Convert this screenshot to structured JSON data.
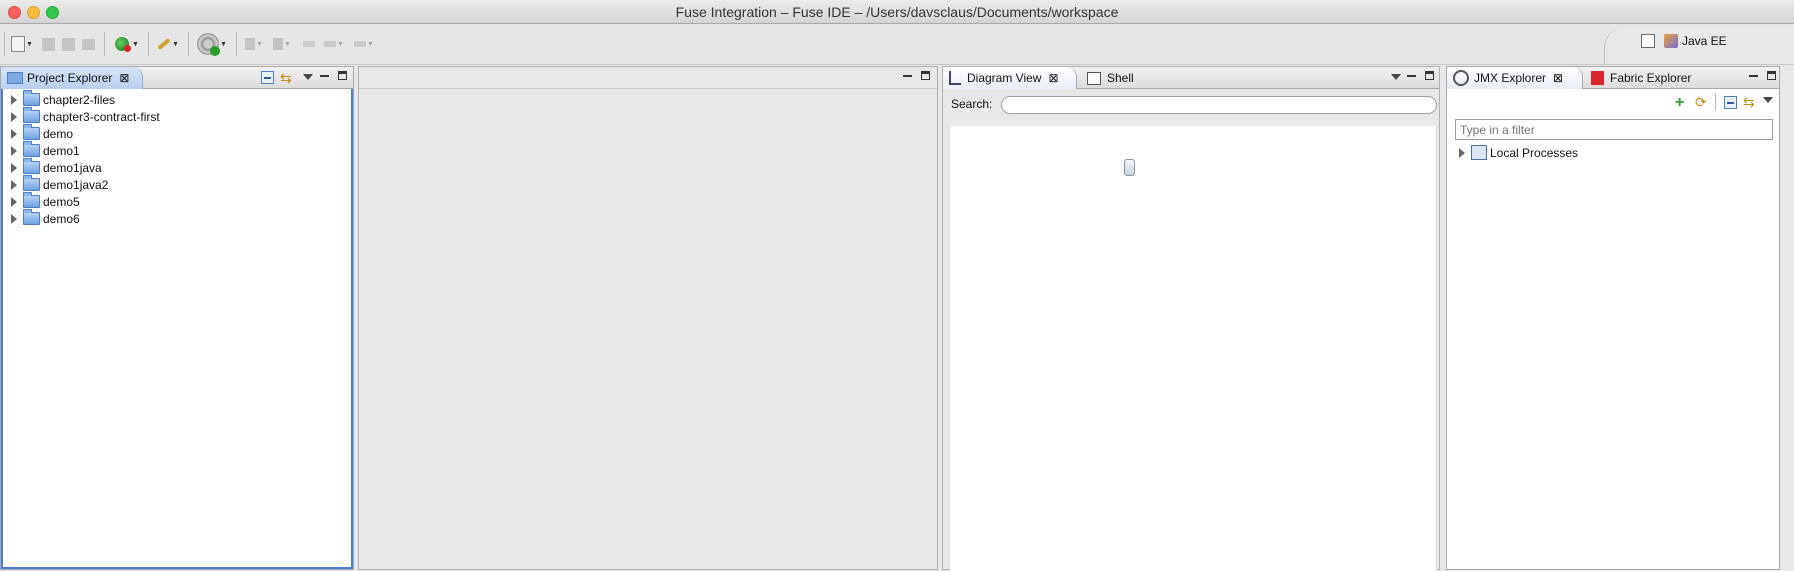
{
  "window": {
    "title": "Fuse Integration  – Fuse IDE – /Users/davsclaus/Documents/workspace"
  },
  "toolbar": {
    "overflow_label": "»",
    "perspective_label": "Java EE"
  },
  "colors": {
    "close": "#fc605c",
    "minimize": "#fdbc40",
    "zoom": "#34c84a",
    "selection_tab": "#b9cff0",
    "tree_border": "#4a7fd6"
  },
  "project_explorer": {
    "tab_label": "Project Explorer",
    "items": [
      {
        "label": "chapter2-files"
      },
      {
        "label": "chapter3-contract-first"
      },
      {
        "label": "demo"
      },
      {
        "label": "demo1"
      },
      {
        "label": "demo1java"
      },
      {
        "label": "demo1java2"
      },
      {
        "label": "demo5"
      },
      {
        "label": "demo6"
      }
    ]
  },
  "diagram": {
    "tabs": [
      {
        "label": "Diagram View"
      },
      {
        "label": "Shell"
      }
    ],
    "search_label": "Search:",
    "search_value": ""
  },
  "jmx": {
    "tabs": [
      {
        "label": "JMX Explorer"
      },
      {
        "label": "Fabric Explorer"
      }
    ],
    "filter_placeholder": "Type in a filter",
    "tree": [
      {
        "label": "Local Processes"
      }
    ]
  }
}
